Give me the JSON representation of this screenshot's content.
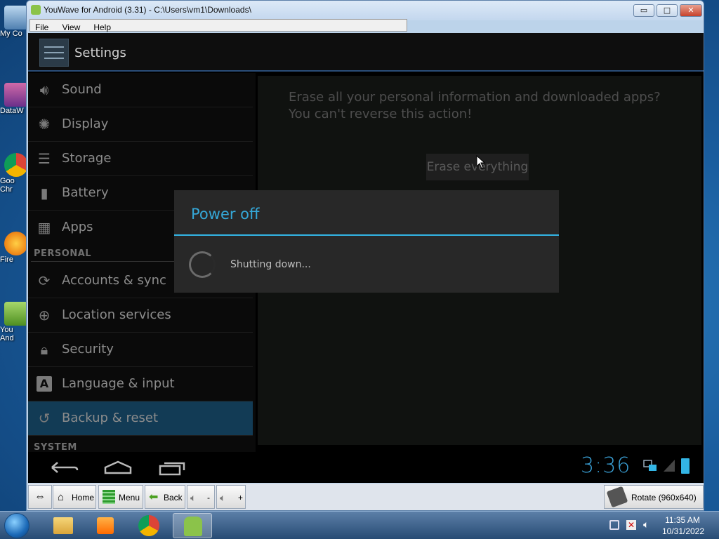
{
  "desktop": {
    "icons": [
      {
        "label": "My Co",
        "icon": "computer-icon"
      },
      {
        "label": "DataW",
        "icon": "app-shortcut-icon"
      },
      {
        "label": "Goo",
        "label2": "Chr",
        "icon": "chrome-icon"
      },
      {
        "label": "Fire",
        "icon": "firefox-icon"
      },
      {
        "label": "You",
        "label2": "And",
        "icon": "youwave-icon"
      }
    ]
  },
  "window": {
    "title": "YouWave for Android (3.31) - C:\\Users\\vm1\\Downloads\\",
    "controls": {
      "minimize": "▭",
      "maximize": "□",
      "close": "✕"
    },
    "menu": [
      "File",
      "View",
      "Help"
    ]
  },
  "android": {
    "actionbar_title": "Settings",
    "nav_items": [
      {
        "label": "Sound",
        "icon": "volume-icon"
      },
      {
        "label": "Display",
        "icon": "brightness-icon"
      },
      {
        "label": "Storage",
        "icon": "storage-icon"
      },
      {
        "label": "Battery",
        "icon": "battery-icon"
      },
      {
        "label": "Apps",
        "icon": "apps-icon"
      }
    ],
    "section_personal": "PERSONAL",
    "personal_items": [
      {
        "label": "Accounts & sync",
        "icon": "sync-icon"
      },
      {
        "label": "Location services",
        "icon": "location-icon"
      },
      {
        "label": "Security",
        "icon": "lock-icon"
      },
      {
        "label": "Language & input",
        "icon": "keyboard-icon"
      },
      {
        "label": "Backup & reset",
        "icon": "backup-icon",
        "active": true
      }
    ],
    "section_system": "SYSTEM",
    "erase_text": "Erase all your personal information and downloaded apps? You can't reverse this action!",
    "erase_button": "Erase everything",
    "dialog": {
      "title": "Power off",
      "message": "Shutting down..."
    },
    "clock": "3:36"
  },
  "toolbar": {
    "home": "Home",
    "menu": "Menu",
    "back": "Back",
    "vol_minus": "-",
    "vol_plus": "+",
    "rotate": "Rotate (960x640)"
  },
  "taskbar": {
    "time": "11:35 AM",
    "date": "10/31/2022"
  }
}
